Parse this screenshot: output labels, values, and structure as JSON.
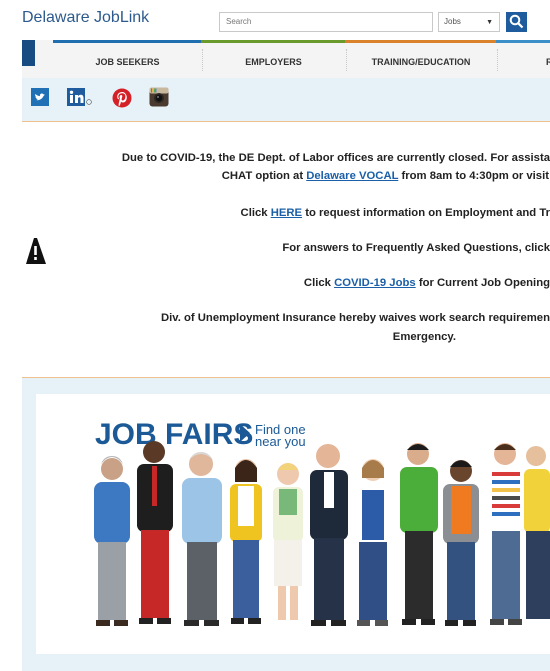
{
  "header": {
    "brand": "Delaware JobLink",
    "search_placeholder": "Search",
    "search_scope": "Jobs"
  },
  "nav": {
    "items": [
      {
        "label": "JOB SEEKERS",
        "color": "#1f6fb0"
      },
      {
        "label": "EMPLOYERS",
        "color": "#6a9a2b"
      },
      {
        "label": "TRAINING/EDUCATION",
        "color": "#d9822b"
      },
      {
        "label": "R",
        "color": "#3a8fc9"
      }
    ]
  },
  "social": {
    "icons": [
      "twitter-icon",
      "linkedin-icon",
      "pinterest-icon",
      "instagram-icon"
    ]
  },
  "notice": {
    "p1_a": "Due to COVID-19, the DE Dept. of Labor offices are currently closed. For assista",
    "p1_b_pre": "CHAT option at ",
    "p1_b_link": "Delaware VOCAL",
    "p1_b_post": " from 8am to 4:30pm or visit",
    "p2_pre": "Click ",
    "p2_link": "HERE",
    "p2_post": " to request information on Employment and Tr",
    "p3": "For answers to Frequently Asked Questions, click",
    "p4_pre": "Click ",
    "p4_link": "COVID-19 Jobs",
    "p4_post": " for Current Job Opening",
    "p5_a": "Div. of Unemployment Insurance hereby waives work search requiremen",
    "p5_b": "Emergency."
  },
  "banner": {
    "title": "JOB FAIRS",
    "sub1": "Find one",
    "sub2": "near you"
  },
  "colors": {
    "brand_blue": "#1b5a96",
    "link_blue": "#1a5fa8",
    "social_bg": "#e7f1f8",
    "accent_orange": "#f0c18c"
  }
}
